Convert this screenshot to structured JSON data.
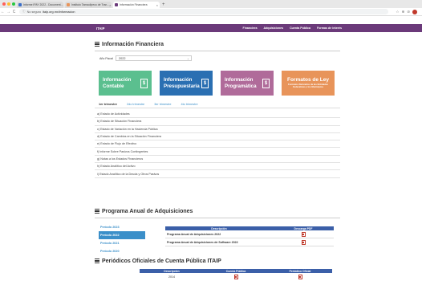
{
  "browser": {
    "tabs": [
      {
        "label": "Informe IPAY 2022 - Document...",
        "active": false
      },
      {
        "label": "Instituto Tamaulipeco de Tran...",
        "active": false
      },
      {
        "label": "Información Financiera",
        "active": true
      }
    ],
    "newtab": "+",
    "url_prefix": "No seguro",
    "url_host": "itaip.org.mx/informacion",
    "lock_icon": "info-icon",
    "back": "←",
    "forward": "→",
    "reload": "C",
    "right_icons": [
      "☆",
      "⊕",
      "⊘"
    ]
  },
  "site": {
    "logo": "ITAIP",
    "nav": [
      "Financiera",
      "Adquisiciones",
      "Cuenta Pública",
      "Formas de interés"
    ],
    "nav_color": "#6b3a7a"
  },
  "info": {
    "title": "Información Financiera",
    "year_label": "Año Fiscal",
    "year_value": "2022",
    "cards": [
      {
        "title": "Información Contable",
        "color": "#5bbf8f",
        "icon": "$"
      },
      {
        "title": "Información Presupuestaria",
        "color": "#2a6fb2",
        "icon": "$"
      },
      {
        "title": "Información Programática",
        "color": "#b06b9a",
        "icon": "$"
      },
      {
        "title": "Formatos de Ley",
        "subtitle": "Formatos Derivados de las Entidades Federativas y los Municipios",
        "color": "#e8945a"
      }
    ],
    "trimester_tabs": [
      {
        "label": "1er trimestre",
        "active": true
      },
      {
        "label": "2do trimestre",
        "active": false
      },
      {
        "label": "3er trimestre",
        "active": false
      },
      {
        "label": "4to trimestre",
        "active": false
      }
    ],
    "reports": [
      "a) Estado de Actividades",
      "b) Estado de Situación Financiera",
      "c) Estado de Variación en la Hacienda Pública",
      "d) Estado de Cambios en la Situación Financiera",
      "e) Estado de Flujo de Efectivo",
      "f) Informe Sobre Pasivos Contingentes",
      "g) Notas a los Estados Financieros",
      "h) Estado Analítico del Activo",
      "i) Estado Analítico de la Deuda y Otros Pasivos"
    ]
  },
  "programa_anual": {
    "title": "Programa Anual de Adquisiciones",
    "periods": [
      {
        "label": "Período 2023",
        "active": false
      },
      {
        "label": "Período 2022",
        "active": true
      },
      {
        "label": "Período 2021",
        "active": false
      },
      {
        "label": "Período 2020",
        "active": false
      }
    ],
    "headers": [
      "Descripción",
      "Descarga PDF"
    ],
    "rows": [
      "Programa Anual de Adquisiciones 2022",
      "Programa Anual de Adquisiciones de Software 2022"
    ]
  },
  "periodicos": {
    "title": "Periódicos Oficiales de Cuenta Pública ITAIP",
    "headers": [
      "Descripción",
      "Cuenta Pública",
      "Periódico Oficial"
    ],
    "rows": [
      {
        "year": "2014"
      }
    ]
  }
}
